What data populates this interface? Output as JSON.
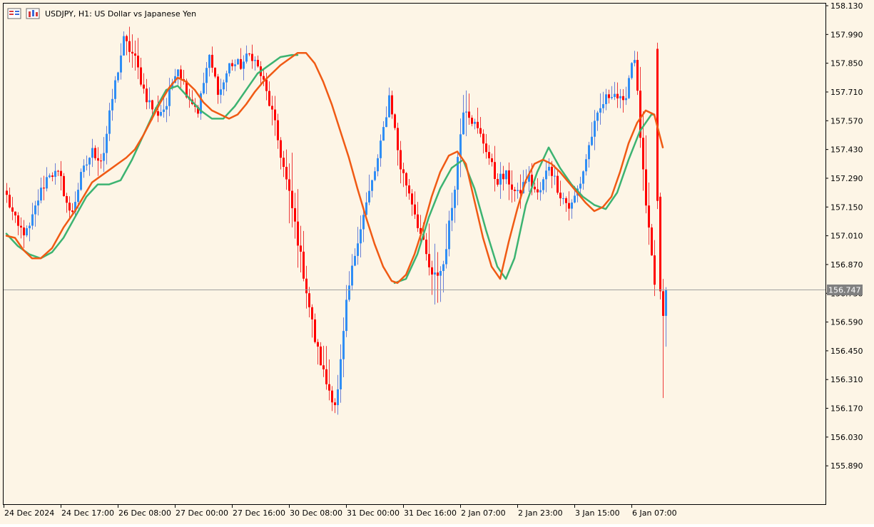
{
  "header": {
    "symbol_line": "USDJPY, H1:  US Dollar vs Japanese Yen"
  },
  "colors": {
    "background": "#fdf5e6",
    "frame": "#000000",
    "bull_candle": "#2f8ef5",
    "bear_candle": "#ff0000",
    "bull_wick": "#6a7fd6",
    "bear_wick": "#ee3a3a",
    "fast_ma": "#f05a14",
    "slow_ma": "#3cb371",
    "price_line": "#a0a0a0",
    "price_tag_bg": "#808080",
    "price_tag_text": "#ffffff"
  },
  "chart_data": {
    "type": "candlestick",
    "symbol": "USDJPY",
    "timeframe": "H1",
    "current_price": "156.747",
    "current_price_value": 156.747,
    "ylim": [
      155.797,
      158.13
    ],
    "y_ticks": [
      "158.130",
      "157.990",
      "157.850",
      "157.710",
      "157.570",
      "157.430",
      "157.290",
      "157.150",
      "157.010",
      "156.870",
      "156.730",
      "156.590",
      "156.450",
      "156.310",
      "156.170",
      "156.030",
      "155.890"
    ],
    "x_ticks": [
      "24 Dec 2024",
      "24 Dec 17:00",
      "26 Dec 08:00",
      "27 Dec 00:00",
      "27 Dec 16:00",
      "30 Dec 08:00",
      "31 Dec 00:00",
      "31 Dec 16:00",
      "2 Jan 07:00",
      "2 Jan 23:00",
      "3 Jan 15:00",
      "6 Jan 07:00"
    ],
    "grid": false,
    "candle_anchors": [
      [
        157.2,
        157.3,
        157.12
      ],
      [
        157.05,
        157.08,
        156.92
      ],
      [
        157.02,
        157.1,
        156.9
      ],
      [
        157.2,
        157.3,
        157.1
      ],
      [
        157.32,
        157.38,
        157.2
      ],
      [
        157.3,
        157.36,
        157.14
      ],
      [
        157.1,
        157.16,
        156.98
      ],
      [
        157.3,
        157.4,
        157.25
      ],
      [
        157.42,
        157.5,
        157.34
      ],
      [
        157.38,
        157.48,
        157.25
      ],
      [
        157.7,
        157.8,
        157.6
      ],
      [
        157.96,
        158.12,
        157.92
      ],
      [
        157.88,
        158.05,
        157.8
      ],
      [
        157.7,
        157.8,
        157.6
      ],
      [
        157.6,
        157.72,
        157.5
      ],
      [
        157.64,
        157.74,
        157.56
      ],
      [
        157.85,
        157.9,
        157.76
      ],
      [
        157.7,
        157.8,
        157.6
      ],
      [
        157.62,
        157.7,
        157.4
      ],
      [
        157.88,
        157.95,
        157.78
      ],
      [
        157.7,
        157.78,
        157.6
      ],
      [
        157.85,
        157.92,
        157.76
      ],
      [
        157.84,
        157.95,
        157.78
      ],
      [
        157.9,
        157.98,
        157.84
      ],
      [
        157.78,
        157.9,
        157.7
      ],
      [
        157.6,
        157.7,
        157.45
      ],
      [
        157.35,
        157.5,
        157.2
      ],
      [
        157.1,
        157.3,
        156.75
      ],
      [
        156.8,
        157.0,
        156.7
      ],
      [
        156.5,
        156.6,
        156.3
      ],
      [
        156.3,
        156.48,
        156.12
      ],
      [
        156.18,
        156.3,
        156.02
      ],
      [
        156.7,
        156.85,
        156.58
      ],
      [
        157.0,
        157.1,
        156.86
      ],
      [
        157.2,
        157.34,
        157.1
      ],
      [
        157.4,
        157.45,
        157.3
      ],
      [
        157.7,
        157.78,
        157.6
      ],
      [
        157.35,
        157.5,
        157.28
      ],
      [
        157.2,
        157.3,
        157.1
      ],
      [
        157.0,
        157.15,
        156.86
      ],
      [
        156.8,
        156.95,
        156.45
      ],
      [
        156.85,
        157.15,
        156.7
      ],
      [
        157.2,
        157.3,
        157.06
      ],
      [
        157.66,
        157.85,
        157.52
      ],
      [
        157.55,
        157.7,
        157.48
      ],
      [
        157.45,
        157.58,
        157.36
      ],
      [
        157.28,
        157.42,
        157.18
      ],
      [
        157.3,
        157.4,
        157.18
      ],
      [
        157.2,
        157.3,
        157.08
      ],
      [
        157.3,
        157.38,
        157.2
      ],
      [
        157.2,
        157.3,
        157.14
      ],
      [
        157.36,
        157.44,
        157.25
      ],
      [
        157.22,
        157.35,
        157.18
      ],
      [
        157.14,
        157.24,
        157.06
      ],
      [
        157.28,
        157.34,
        157.18
      ],
      [
        157.5,
        157.62,
        157.4
      ],
      [
        157.65,
        157.78,
        157.56
      ],
      [
        157.72,
        157.78,
        157.6
      ],
      [
        157.64,
        157.72,
        157.54
      ],
      [
        157.92,
        157.98,
        157.82
      ],
      [
        157.2,
        157.4,
        156.9
      ],
      [
        156.74,
        156.82,
        156.6
      ],
      [
        156.66,
        156.76,
        156.24
      ]
    ],
    "candle_count": 232,
    "fast_ma_points": [
      [
        0,
        157.01
      ],
      [
        3,
        157.0
      ],
      [
        6,
        156.94
      ],
      [
        9,
        156.9
      ],
      [
        12,
        156.9
      ],
      [
        16,
        156.95
      ],
      [
        20,
        157.05
      ],
      [
        24,
        157.13
      ],
      [
        27,
        157.2
      ],
      [
        30,
        157.27
      ],
      [
        33,
        157.3
      ],
      [
        36,
        157.33
      ],
      [
        39,
        157.36
      ],
      [
        42,
        157.39
      ],
      [
        45,
        157.43
      ],
      [
        48,
        157.5
      ],
      [
        51,
        157.58
      ],
      [
        54,
        157.66
      ],
      [
        57,
        157.73
      ],
      [
        60,
        157.78
      ],
      [
        63,
        157.76
      ],
      [
        66,
        157.72
      ],
      [
        69,
        157.66
      ],
      [
        72,
        157.62
      ],
      [
        75,
        157.6
      ],
      [
        78,
        157.58
      ],
      [
        81,
        157.6
      ],
      [
        84,
        157.65
      ],
      [
        87,
        157.71
      ],
      [
        90,
        157.76
      ],
      [
        93,
        157.8
      ],
      [
        96,
        157.84
      ],
      [
        99,
        157.87
      ],
      [
        102,
        157.9
      ],
      [
        105,
        157.9
      ],
      [
        108,
        157.85
      ],
      [
        111,
        157.76
      ],
      [
        114,
        157.65
      ],
      [
        117,
        157.52
      ],
      [
        120,
        157.39
      ],
      [
        123,
        157.24
      ],
      [
        126,
        157.1
      ],
      [
        129,
        156.97
      ],
      [
        132,
        156.86
      ],
      [
        135,
        156.79
      ],
      [
        137,
        156.78
      ],
      [
        140,
        156.82
      ],
      [
        143,
        156.92
      ],
      [
        146,
        157.05
      ],
      [
        149,
        157.2
      ],
      [
        152,
        157.32
      ],
      [
        155,
        157.4
      ],
      [
        158,
        157.42
      ],
      [
        161,
        157.36
      ],
      [
        164,
        157.18
      ],
      [
        167,
        157.0
      ],
      [
        170,
        156.86
      ],
      [
        173,
        156.8
      ],
      [
        176,
        156.98
      ],
      [
        179,
        157.14
      ],
      [
        182,
        157.28
      ],
      [
        185,
        157.36
      ],
      [
        188,
        157.38
      ],
      [
        191,
        157.36
      ],
      [
        194,
        157.32
      ],
      [
        197,
        157.27
      ],
      [
        200,
        157.22
      ],
      [
        203,
        157.17
      ],
      [
        206,
        157.13
      ],
      [
        209,
        157.15
      ],
      [
        212,
        157.2
      ],
      [
        215,
        157.32
      ],
      [
        218,
        157.46
      ],
      [
        221,
        157.56
      ],
      [
        224,
        157.62
      ],
      [
        227,
        157.6
      ],
      [
        230,
        157.44
      ]
    ],
    "slow_ma_points": [
      [
        0,
        157.02
      ],
      [
        4,
        156.96
      ],
      [
        8,
        156.92
      ],
      [
        12,
        156.9
      ],
      [
        16,
        156.93
      ],
      [
        20,
        157.0
      ],
      [
        24,
        157.1
      ],
      [
        28,
        157.2
      ],
      [
        32,
        157.26
      ],
      [
        36,
        157.26
      ],
      [
        40,
        157.28
      ],
      [
        44,
        157.38
      ],
      [
        48,
        157.5
      ],
      [
        52,
        157.62
      ],
      [
        56,
        157.72
      ],
      [
        60,
        157.74
      ],
      [
        64,
        157.68
      ],
      [
        68,
        157.62
      ],
      [
        72,
        157.58
      ],
      [
        76,
        157.58
      ],
      [
        80,
        157.64
      ],
      [
        84,
        157.72
      ],
      [
        88,
        157.8
      ],
      [
        92,
        157.84
      ],
      [
        96,
        157.88
      ],
      [
        100,
        157.89
      ],
      [
        102,
        157.89
      ]
    ],
    "slow_ma_points_2": [
      [
        136,
        156.78
      ],
      [
        140,
        156.8
      ],
      [
        144,
        156.92
      ],
      [
        148,
        157.1
      ],
      [
        152,
        157.24
      ],
      [
        156,
        157.34
      ],
      [
        160,
        157.38
      ],
      [
        164,
        157.24
      ],
      [
        168,
        157.04
      ],
      [
        172,
        156.86
      ],
      [
        175,
        156.8
      ],
      [
        178,
        156.9
      ],
      [
        182,
        157.16
      ],
      [
        186,
        157.32
      ],
      [
        190,
        157.44
      ],
      [
        194,
        157.34
      ],
      [
        198,
        157.26
      ],
      [
        202,
        157.2
      ],
      [
        206,
        157.16
      ],
      [
        210,
        157.14
      ],
      [
        214,
        157.22
      ],
      [
        218,
        157.38
      ],
      [
        222,
        157.52
      ],
      [
        226,
        157.6
      ],
      [
        227,
        157.6
      ]
    ]
  }
}
